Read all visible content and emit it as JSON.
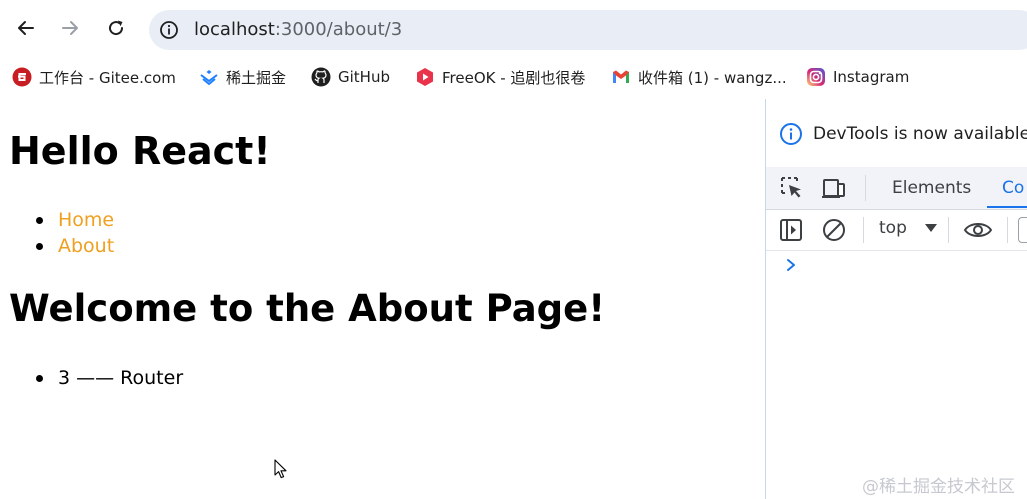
{
  "browser": {
    "url_host": "localhost",
    "url_rest": ":3000/about/3"
  },
  "bookmarks": [
    {
      "label": "工作台 - Gitee.com",
      "icon": "gitee-icon"
    },
    {
      "label": "稀土掘金",
      "icon": "juejin-icon"
    },
    {
      "label": "GitHub",
      "icon": "github-icon"
    },
    {
      "label": "FreeOK - 追剧也很卷",
      "icon": "freeok-icon"
    },
    {
      "label": "收件箱 (1) - wangz...",
      "icon": "gmail-icon"
    },
    {
      "label": "Instagram",
      "icon": "instagram-icon"
    }
  ],
  "page": {
    "title": "Hello React!",
    "nav": [
      {
        "label": "Home"
      },
      {
        "label": "About"
      }
    ],
    "heading": "Welcome to the About Page!",
    "params": [
      {
        "text": "3 —— Router"
      }
    ]
  },
  "devtools": {
    "banner": "DevTools is now available",
    "tabs": [
      {
        "label": "Elements"
      },
      {
        "label": "Co"
      }
    ],
    "context": "top"
  },
  "watermark": "@稀土掘金技术社区",
  "colors": {
    "link": "#f0a020",
    "accent": "#1a73e8",
    "address_bar": "#e9eef6"
  }
}
